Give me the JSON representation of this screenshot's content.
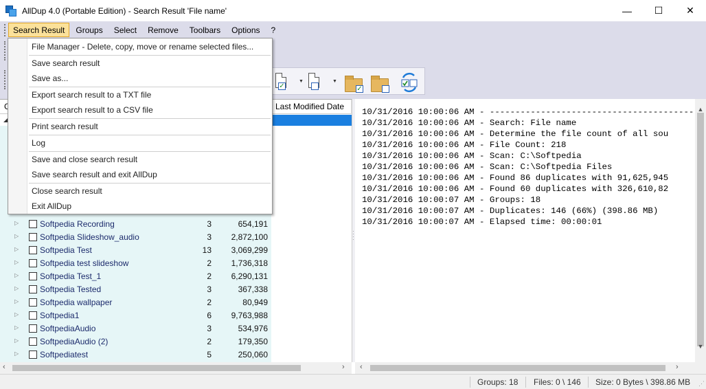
{
  "window": {
    "title": "AllDup 4.0 (Portable Edition) - Search Result 'File name'",
    "controls": [
      "—",
      "☐",
      "✕"
    ]
  },
  "menubar": {
    "items": [
      "Search Result",
      "Groups",
      "Select",
      "Remove",
      "Toolbars",
      "Options",
      "?"
    ],
    "active": "Search Result"
  },
  "dropdown": {
    "items": [
      "File Manager - Delete, copy, move or rename selected files...",
      "Save search result",
      "Save as...",
      "Export search result to a TXT file",
      "Export search result to a CSV file",
      "Print search result",
      "Log",
      "Save and close search result",
      "Save search result and exit AllDup",
      "Close search result",
      "Exit AllDup"
    ]
  },
  "table": {
    "headers": {
      "first": "G",
      "last_modified": "Last Modified Date"
    },
    "rows": [
      {
        "name": "Softpedia Recording",
        "count": "3",
        "size": "654,191"
      },
      {
        "name": "Softpedia Slideshow_audio",
        "count": "3",
        "size": "2,872,100"
      },
      {
        "name": "Softpedia Test",
        "count": "13",
        "size": "3,069,299"
      },
      {
        "name": "Softpedia test slideshow",
        "count": "2",
        "size": "1,736,318"
      },
      {
        "name": "Softpedia Test_1",
        "count": "2",
        "size": "6,290,131"
      },
      {
        "name": "Softpedia Tested",
        "count": "3",
        "size": "367,338"
      },
      {
        "name": "Softpedia wallpaper",
        "count": "2",
        "size": "80,949"
      },
      {
        "name": "Softpedia1",
        "count": "6",
        "size": "9,763,988"
      },
      {
        "name": "SoftpediaAudio",
        "count": "3",
        "size": "534,976"
      },
      {
        "name": "SoftpediaAudio (2)",
        "count": "2",
        "size": "179,350"
      },
      {
        "name": "Softpediatest",
        "count": "5",
        "size": "250,060"
      }
    ]
  },
  "log": {
    "lines": [
      "10/31/2016 10:00:06 AM - ----------------------------------------",
      "10/31/2016 10:00:06 AM - Search: File name",
      "10/31/2016 10:00:06 AM - Determine the file count of all sou",
      "10/31/2016 10:00:06 AM - File Count: 218",
      "10/31/2016 10:00:06 AM - Scan: C:\\Softpedia",
      "10/31/2016 10:00:06 AM - Scan: C:\\Softpedia Files",
      "10/31/2016 10:00:06 AM - Found 86 duplicates with 91,625,945",
      "10/31/2016 10:00:06 AM - Found 60 duplicates with 326,610,82",
      "10/31/2016 10:00:07 AM - Groups: 18",
      "10/31/2016 10:00:07 AM - Duplicates: 146 (66%) (398.86 MB)",
      "10/31/2016 10:00:07 AM - Elapsed time: 00:00:01"
    ]
  },
  "statusbar": {
    "groups": "Groups: 18",
    "files": "Files: 0 \\ 146",
    "size": "Size: 0 Bytes \\ 398.86 MB"
  },
  "colors": {
    "menubar_bg": "#dcdcea",
    "active_menu": "#fbe19a",
    "selection": "#1a7fe0",
    "grid_bg": "#e6f6f7"
  }
}
